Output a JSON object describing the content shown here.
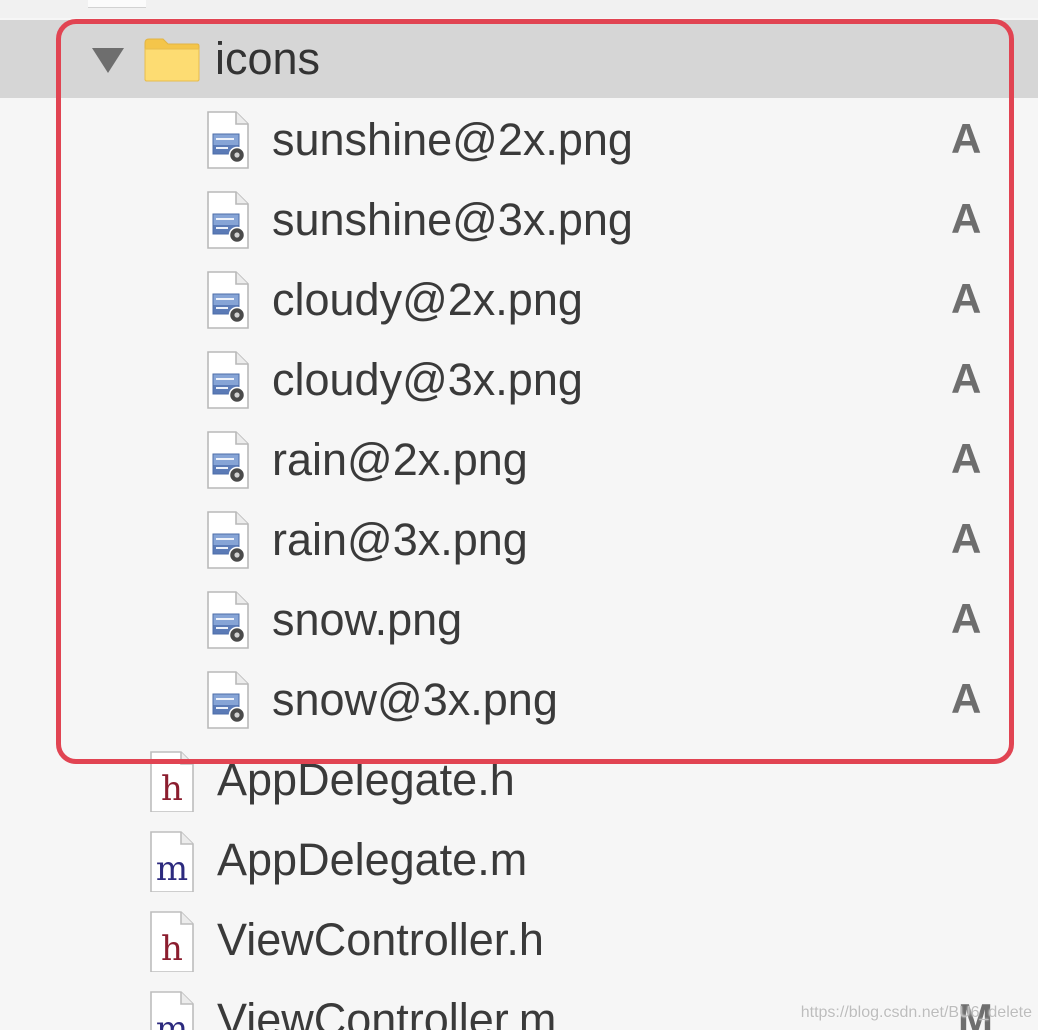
{
  "navigator": {
    "folder": {
      "name": "icons",
      "expanded": true,
      "files": [
        {
          "name": "sunshine@2x.png",
          "status": "A"
        },
        {
          "name": "sunshine@3x.png",
          "status": "A"
        },
        {
          "name": "cloudy@2x.png",
          "status": "A"
        },
        {
          "name": "cloudy@3x.png",
          "status": "A"
        },
        {
          "name": "rain@2x.png",
          "status": "A"
        },
        {
          "name": "rain@3x.png",
          "status": "A"
        },
        {
          "name": "snow.png",
          "status": "A"
        },
        {
          "name": "snow@3x.png",
          "status": "A"
        }
      ]
    },
    "other_files": [
      {
        "name": "AppDelegate.h",
        "type": "h"
      },
      {
        "name": "AppDelegate.m",
        "type": "m"
      },
      {
        "name": "ViewController.h",
        "type": "h"
      },
      {
        "name": "ViewController.m",
        "type": "m",
        "status": "M"
      }
    ]
  },
  "icons": {
    "disclosure": "disclosure-triangle-icon",
    "folder": "folder-icon",
    "image_file": "image-file-icon",
    "header_file": "header-file-icon",
    "implementation_file": "implementation-file-icon"
  },
  "colors": {
    "highlight_outline": "#e14452",
    "selected_row": "#d6d6d6",
    "header_glyph": "#8b1d2e",
    "implementation_glyph": "#2c2a7e",
    "status_text": "#6e6e6e"
  },
  "watermark": "https://blog.csdn.net/BU6_delete"
}
